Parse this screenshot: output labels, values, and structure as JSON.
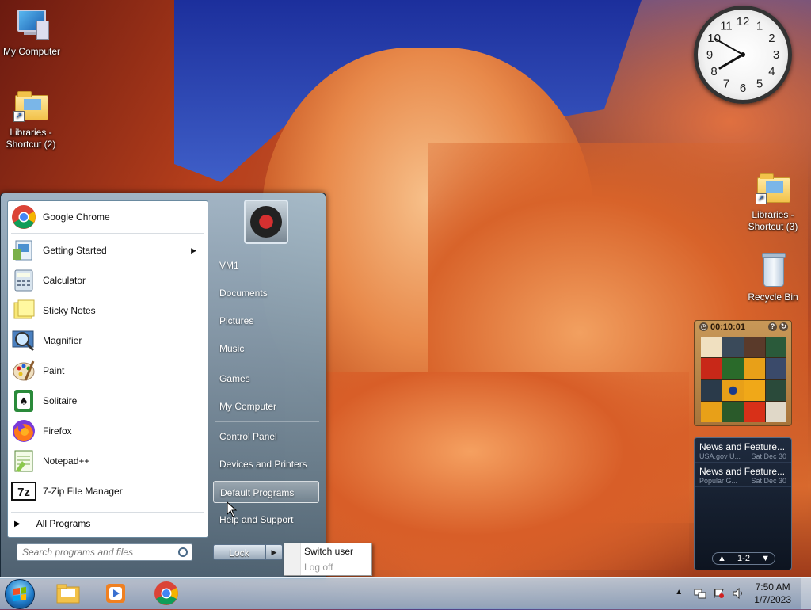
{
  "desktop": {
    "icons": [
      {
        "label": "My Computer"
      },
      {
        "label": "Libraries - Shortcut (2)"
      },
      {
        "label": "Libraries - Shortcut (3)"
      },
      {
        "label": "Recycle Bin"
      }
    ]
  },
  "gadgets": {
    "clock": {
      "numerals": [
        "12",
        "1",
        "2",
        "3",
        "4",
        "5",
        "6",
        "7",
        "8",
        "9",
        "10",
        "11"
      ]
    },
    "puzzle": {
      "timer": "00:10:01"
    },
    "feed": {
      "items": [
        {
          "title": "News and Feature...",
          "source": "USA.gov U...",
          "date": "Sat Dec 30"
        },
        {
          "title": "News and Feature...",
          "source": "Popular G...",
          "date": "Sat Dec 30"
        }
      ],
      "page": "1-2"
    }
  },
  "start_menu": {
    "programs": [
      {
        "label": "Google Chrome",
        "icon": "chrome-icon"
      },
      {
        "label": "Getting Started",
        "icon": "getting-started-icon",
        "submenu": true
      },
      {
        "label": "Calculator",
        "icon": "calculator-icon"
      },
      {
        "label": "Sticky Notes",
        "icon": "sticky-notes-icon"
      },
      {
        "label": "Magnifier",
        "icon": "magnifier-icon"
      },
      {
        "label": "Paint",
        "icon": "paint-icon"
      },
      {
        "label": "Solitaire",
        "icon": "solitaire-icon"
      },
      {
        "label": "Firefox",
        "icon": "firefox-icon"
      },
      {
        "label": "Notepad++",
        "icon": "notepad-plus-icon"
      },
      {
        "label": "7-Zip File Manager",
        "icon": "seven-zip-icon"
      }
    ],
    "all_programs": "All Programs",
    "search_placeholder": "Search programs and files",
    "right_links": [
      {
        "label": "VM1"
      },
      {
        "label": "Documents"
      },
      {
        "label": "Pictures"
      },
      {
        "label": "Music"
      },
      {
        "label": "Games"
      },
      {
        "label": "My Computer"
      },
      {
        "label": "Control Panel"
      },
      {
        "label": "Devices and Printers"
      },
      {
        "label": "Default Programs"
      },
      {
        "label": "Help and Support"
      }
    ],
    "lock_label": "Lock",
    "power_menu": [
      "Switch user",
      "Log off"
    ]
  },
  "taskbar": {
    "time": "7:50 AM",
    "date": "1/7/2023"
  },
  "colors": {
    "taskbar": "#a8c4dc",
    "start_menu_right": "#5a7a90",
    "highlight": "#ffffff"
  }
}
